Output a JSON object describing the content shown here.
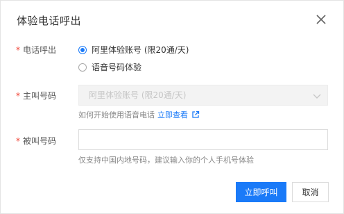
{
  "dialog": {
    "title": "体验电话呼出",
    "close_icon": "close-icon"
  },
  "call_out": {
    "label": "电话呼出",
    "required_mark": "*",
    "options": [
      {
        "label": "阿里体验账号 (限20通/天)",
        "selected": true
      },
      {
        "label": "语音号码体验",
        "selected": false
      }
    ]
  },
  "caller_number": {
    "label": "主叫号码",
    "required_mark": "*",
    "value": "阿里体验账号 (限20通/天)",
    "disabled": true,
    "hint": "如何开始使用语音电话",
    "link": "立即查看",
    "link_icon": "external-link-icon"
  },
  "callee_number": {
    "label": "被叫号码",
    "required_mark": "*",
    "value": "",
    "hint": "仅支持中国内地号码，建议输入你的个人手机号体验"
  },
  "footer": {
    "confirm_label": "立即呼叫",
    "cancel_label": "取消"
  },
  "colors": {
    "primary": "#1a7af8",
    "required": "#f04134"
  }
}
